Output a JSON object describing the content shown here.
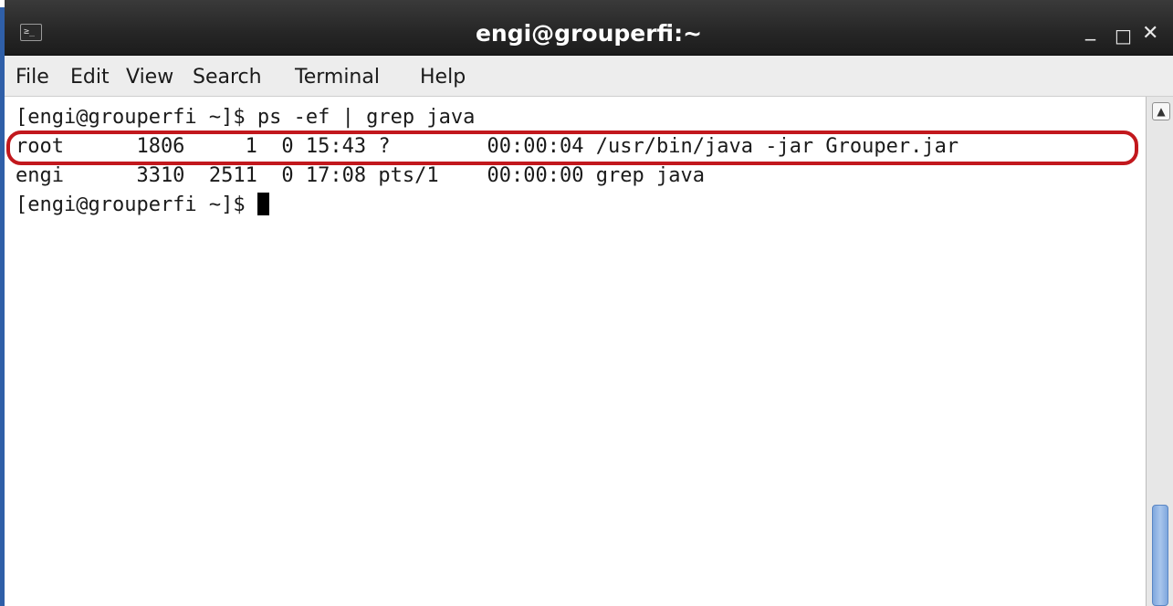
{
  "window": {
    "title": "engi@grouperfi:~",
    "icon_name": "terminal-icon",
    "icon_glyph": "≥_",
    "controls": {
      "minimize": "_",
      "maximize": "□",
      "close": "✕"
    }
  },
  "menu": {
    "items": [
      "File",
      "Edit",
      "View",
      "Search",
      "Terminal",
      "Help"
    ]
  },
  "terminal": {
    "lines": [
      "[engi@grouperfi ~]$ ps -ef | grep java",
      "root      1806     1  0 15:43 ?        00:00:04 /usr/bin/java -jar Grouper.jar",
      "engi      3310  2511  0 17:08 pts/1    00:00:00 grep java",
      "[engi@grouperfi ~]$ "
    ],
    "highlighted_line": 1
  },
  "scrollbar": {
    "up_arrow": "▲"
  },
  "colors": {
    "titlebar": "#262626",
    "menubar": "#ededed",
    "highlight": "#c2181d",
    "scroll_thumb": "#8fb3e4",
    "accent_edge": "#2f5fa8"
  }
}
